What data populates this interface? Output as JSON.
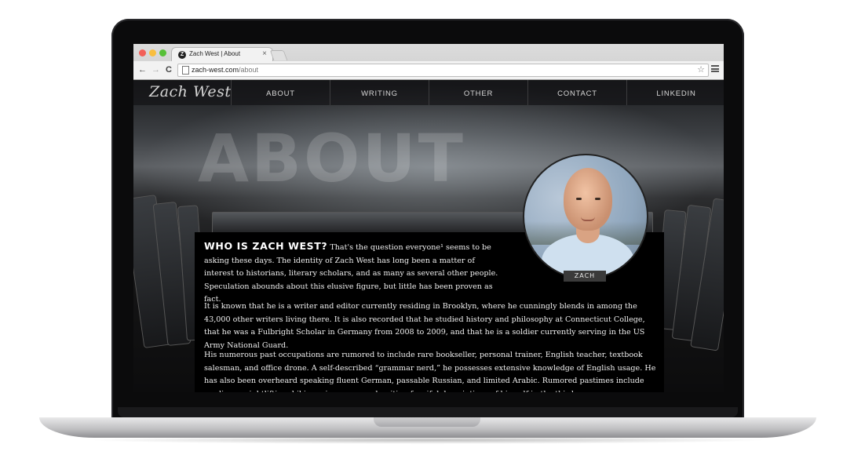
{
  "browser": {
    "tab_title": "Zach West | About",
    "tab_close": "×",
    "favicon_letter": "Z",
    "url_domain": "zach-west.com",
    "url_path": "/about",
    "back": "←",
    "forward": "→",
    "reload": "C",
    "star": "☆"
  },
  "site": {
    "logo": "Zach West",
    "nav": [
      "ABOUT",
      "WRITING",
      "OTHER",
      "CONTACT",
      "LINKEDIN"
    ],
    "hero_title": "ABOUT",
    "avatar_label": "ZACH",
    "lead_heading": "WHO IS ZACH WEST?",
    "lead_text": " That's the question everyone¹ seems to be asking these days. The identity of Zach West has long been a matter of interest to historians, literary scholars, and as many as several other people. Speculation abounds about this elusive figure, but little has been proven as fact.",
    "paragraph_2": "It is known that he is a writer and editor currently residing in Brooklyn, where he cunningly blends in among the 43,000 other writers living there. It is also recorded that he studied history and philosophy at Connecticut College, that he was a Fulbright Scholar in Germany from 2008 to 2009, and that he is a soldier currently serving in the US Army National Guard.",
    "paragraph_3": "His numerous past occupations are rumored to include rare bookseller, personal trainer, English teacher, textbook salesman, and office drone. A self-described “grammar nerd,” he possesses extensive knowledge of English usage. He has also been overheard speaking fluent German, passable Russian, and limited Arabic. Rumored pastimes include reading, weightlifting, hiking, ping-pong, and writing fanciful descriptions of himself in the third person."
  }
}
